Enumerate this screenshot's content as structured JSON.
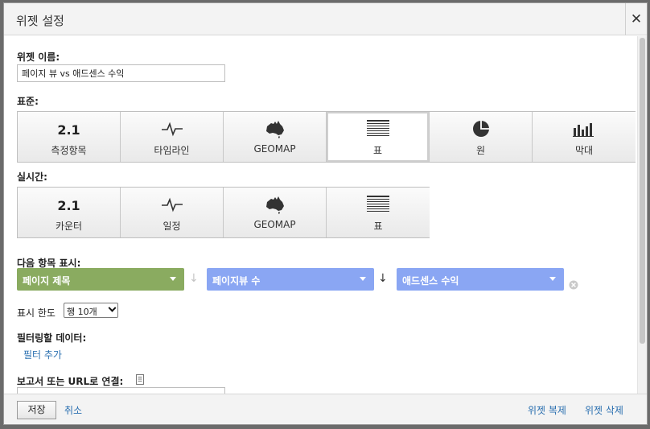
{
  "dialog": {
    "title": "위젯 설정",
    "close_label": "✕"
  },
  "widget_name": {
    "label": "위젯 이름:",
    "value": "페이지 뷰 vs 애드센스 수익"
  },
  "standard": {
    "label": "표준:",
    "buttons": [
      {
        "big": "2.1",
        "label": "측정항목",
        "icon": "metric"
      },
      {
        "label": "타임라인",
        "icon": "timeline"
      },
      {
        "label": "GEOMAP",
        "icon": "geomap"
      },
      {
        "label": "표",
        "icon": "table",
        "selected": true
      },
      {
        "label": "원",
        "icon": "pie"
      },
      {
        "label": "막대",
        "icon": "bar"
      }
    ]
  },
  "realtime": {
    "label": "실시간:",
    "buttons": [
      {
        "big": "2.1",
        "label": "카운터",
        "icon": "metric"
      },
      {
        "label": "일정",
        "icon": "timeline"
      },
      {
        "label": "GEOMAP",
        "icon": "geomap"
      },
      {
        "label": "표",
        "icon": "table"
      }
    ]
  },
  "display": {
    "label": "다음 항목 표시:",
    "dimension": "페이지 제목",
    "metric1": "페이지뷰 수",
    "metric2": "애드센스 수익",
    "colors": {
      "dimension": "#8aab60",
      "metric": "#8aa6f3"
    }
  },
  "limit": {
    "label": "표시 한도",
    "value": "행 10개"
  },
  "filter": {
    "label": "필터링할 데이터:",
    "add_link": "필터 추가"
  },
  "link_to": {
    "label": "보고서 또는 URL로 연결:"
  },
  "footer": {
    "save": "저장",
    "cancel": "취소",
    "clone": "위젯 복제",
    "delete": "위젯 삭제"
  }
}
